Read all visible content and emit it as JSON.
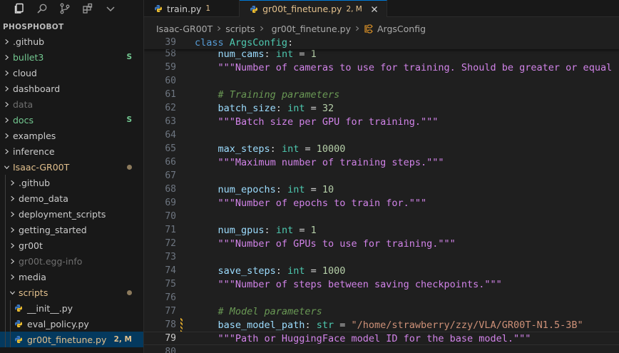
{
  "explorer": {
    "title": "PHOSPHOBOT",
    "items": [
      {
        "label": "github",
        "display": ".github",
        "color": "#cccccc",
        "badge": "",
        "indent": 0
      },
      {
        "label": "bullet3",
        "display": "bullet3",
        "color": "#73c991",
        "badge": "S",
        "indent": 0
      },
      {
        "label": "cloud",
        "display": "cloud",
        "color": "#cccccc",
        "badge": "",
        "indent": 0
      },
      {
        "label": "dashboard",
        "display": "dashboard",
        "color": "#cccccc",
        "badge": "",
        "indent": 0
      },
      {
        "label": "data",
        "display": "data",
        "color": "#6f6f6f",
        "badge": "",
        "indent": 0
      },
      {
        "label": "docs",
        "display": "docs",
        "color": "#73c991",
        "badge": "S",
        "indent": 0
      },
      {
        "label": "examples",
        "display": "examples",
        "color": "#cccccc",
        "badge": "",
        "indent": 0
      },
      {
        "label": "inference",
        "display": "inference",
        "color": "#cccccc",
        "badge": "",
        "indent": 0
      },
      {
        "label": "isaac",
        "display": "Isaac-GR00T",
        "color": "#e2c08d",
        "badge": "",
        "indent": 0,
        "open": true,
        "dot": true
      },
      {
        "label": "isaac-github",
        "display": ".github",
        "color": "#cccccc",
        "badge": "",
        "indent": 1
      },
      {
        "label": "demo-data",
        "display": "demo_data",
        "color": "#cccccc",
        "badge": "",
        "indent": 1
      },
      {
        "label": "deployment-scripts",
        "display": "deployment_scripts",
        "color": "#cccccc",
        "badge": "",
        "indent": 1
      },
      {
        "label": "getting-started",
        "display": "getting_started",
        "color": "#cccccc",
        "badge": "",
        "indent": 1
      },
      {
        "label": "gr00t",
        "display": "gr00t",
        "color": "#cccccc",
        "badge": "",
        "indent": 1
      },
      {
        "label": "gr00t-egg-info",
        "display": "gr00t.egg-info",
        "color": "#6f6f6f",
        "badge": "",
        "indent": 1
      },
      {
        "label": "media",
        "display": "media",
        "color": "#cccccc",
        "badge": "",
        "indent": 1
      },
      {
        "label": "scripts",
        "display": "scripts",
        "color": "#e2c08d",
        "badge": "",
        "indent": 1,
        "open": true,
        "dot": true
      },
      {
        "label": "init-py",
        "display": "__init__.py",
        "color": "#cccccc",
        "badge": "",
        "indent": 2,
        "file": true
      },
      {
        "label": "eval-policy-py",
        "display": "eval_policy.py",
        "color": "#cccccc",
        "badge": "",
        "indent": 2,
        "file": true
      },
      {
        "label": "gr00t-finetune-py",
        "display": "gr00t_finetune.py",
        "color": "#e2c08d",
        "badge": "2, M",
        "indent": 2,
        "file": true,
        "selected": true
      }
    ]
  },
  "tabs": [
    {
      "name": "train.py",
      "badge": "1",
      "active": false
    },
    {
      "name": "gr00t_finetune.py",
      "badge": "2, M",
      "active": true
    }
  ],
  "breadcrumb": [
    "Isaac-GR00T",
    "scripts",
    "gr00t_finetune.py",
    "ArgsConfig"
  ],
  "colors": {
    "accent": "#0078d4",
    "modified": "#e2c08d",
    "untracked": "#73c991",
    "python_icon_a": "#3b78c2",
    "python_icon_b": "#f1c232"
  },
  "editor": {
    "sticky": {
      "ln": "39",
      "tokens": [
        [
          "kw",
          "class "
        ],
        [
          "cls",
          "ArgsConfig"
        ],
        [
          "op",
          ":"
        ]
      ]
    },
    "current_line": "79",
    "lines": [
      {
        "ln": "58",
        "tokens": [
          [
            "op",
            "    "
          ],
          [
            "var",
            "num_cams"
          ],
          [
            "op",
            ": "
          ],
          [
            "typ",
            "int"
          ],
          [
            "op",
            " = "
          ],
          [
            "num",
            "1"
          ]
        ]
      },
      {
        "ln": "59",
        "tokens": [
          [
            "op",
            "    "
          ],
          [
            "doc",
            "\"\"\"Number of cameras to use for training. Should be greater or equal"
          ]
        ]
      },
      {
        "ln": "60",
        "tokens": []
      },
      {
        "ln": "61",
        "tokens": [
          [
            "op",
            "    "
          ],
          [
            "cmt",
            "# Training parameters"
          ]
        ]
      },
      {
        "ln": "62",
        "tokens": [
          [
            "op",
            "    "
          ],
          [
            "var",
            "batch_size"
          ],
          [
            "op",
            ": "
          ],
          [
            "typ",
            "int"
          ],
          [
            "op",
            " = "
          ],
          [
            "num",
            "32"
          ]
        ]
      },
      {
        "ln": "63",
        "tokens": [
          [
            "op",
            "    "
          ],
          [
            "doc",
            "\"\"\"Batch size per GPU for training.\"\"\""
          ]
        ]
      },
      {
        "ln": "64",
        "tokens": []
      },
      {
        "ln": "65",
        "tokens": [
          [
            "op",
            "    "
          ],
          [
            "var",
            "max_steps"
          ],
          [
            "op",
            ": "
          ],
          [
            "typ",
            "int"
          ],
          [
            "op",
            " = "
          ],
          [
            "num",
            "10000"
          ]
        ]
      },
      {
        "ln": "66",
        "tokens": [
          [
            "op",
            "    "
          ],
          [
            "doc",
            "\"\"\"Maximum number of training steps.\"\"\""
          ]
        ]
      },
      {
        "ln": "67",
        "tokens": []
      },
      {
        "ln": "68",
        "tokens": [
          [
            "op",
            "    "
          ],
          [
            "var",
            "num_epochs"
          ],
          [
            "op",
            ": "
          ],
          [
            "typ",
            "int"
          ],
          [
            "op",
            " = "
          ],
          [
            "num",
            "10"
          ]
        ]
      },
      {
        "ln": "69",
        "tokens": [
          [
            "op",
            "    "
          ],
          [
            "doc",
            "\"\"\"Number of epochs to train for.\"\"\""
          ]
        ]
      },
      {
        "ln": "70",
        "tokens": []
      },
      {
        "ln": "71",
        "tokens": [
          [
            "op",
            "    "
          ],
          [
            "var",
            "num_gpus"
          ],
          [
            "op",
            ": "
          ],
          [
            "typ",
            "int"
          ],
          [
            "op",
            " = "
          ],
          [
            "num",
            "1"
          ]
        ]
      },
      {
        "ln": "72",
        "tokens": [
          [
            "op",
            "    "
          ],
          [
            "doc",
            "\"\"\"Number of GPUs to use for training.\"\"\""
          ]
        ]
      },
      {
        "ln": "73",
        "tokens": []
      },
      {
        "ln": "74",
        "tokens": [
          [
            "op",
            "    "
          ],
          [
            "var",
            "save_steps"
          ],
          [
            "op",
            ": "
          ],
          [
            "typ",
            "int"
          ],
          [
            "op",
            " = "
          ],
          [
            "num",
            "1000"
          ]
        ]
      },
      {
        "ln": "75",
        "tokens": [
          [
            "op",
            "    "
          ],
          [
            "doc",
            "\"\"\"Number of steps between saving checkpoints.\"\"\""
          ]
        ]
      },
      {
        "ln": "76",
        "tokens": []
      },
      {
        "ln": "77",
        "tokens": [
          [
            "op",
            "    "
          ],
          [
            "cmt",
            "# Model parameters"
          ]
        ]
      },
      {
        "ln": "78",
        "tokens": [
          [
            "op",
            "    "
          ],
          [
            "var",
            "base_model_path"
          ],
          [
            "op",
            ": "
          ],
          [
            "typ",
            "str"
          ],
          [
            "op",
            " = "
          ],
          [
            "str",
            "\"/home/strawberry/zzy/VLA/GR00T-N1.5-3B\""
          ]
        ],
        "mark": true
      },
      {
        "ln": "79",
        "tokens": [
          [
            "op",
            "    "
          ],
          [
            "doc",
            "\"\"\"Path or HuggingFace model ID for the base model.\"\"\""
          ]
        ]
      },
      {
        "ln": "80",
        "tokens": []
      }
    ]
  }
}
